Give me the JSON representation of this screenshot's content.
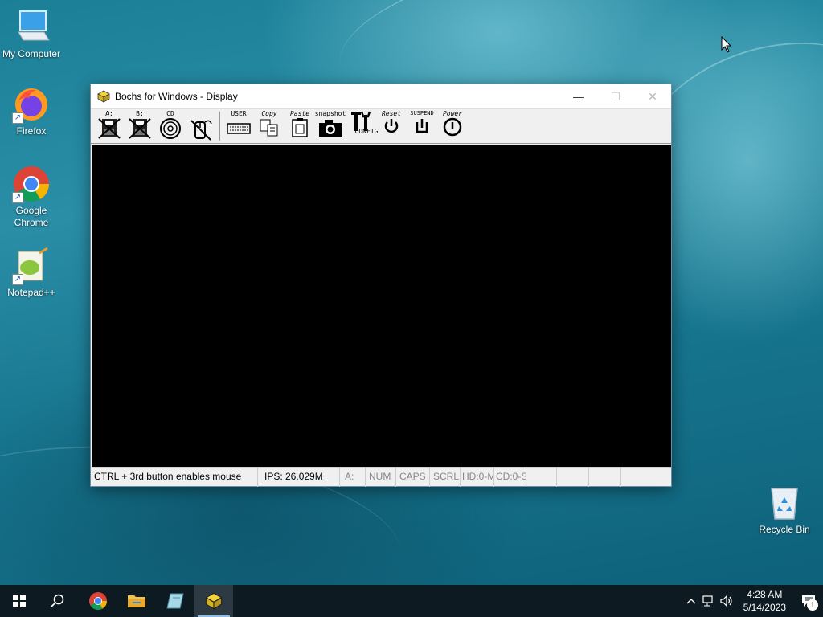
{
  "desktop": {
    "icons": [
      {
        "label": "My Computer",
        "icon": "computer-icon"
      },
      {
        "label": "Firefox",
        "icon": "firefox-icon"
      },
      {
        "label": "Google Chrome",
        "icon": "chrome-icon"
      },
      {
        "label": "Notepad++",
        "icon": "notepad-plus-plus-icon"
      }
    ],
    "recycle_bin": {
      "label": "Recycle Bin",
      "icon": "recycle-bin-icon"
    }
  },
  "window": {
    "title": "Bochs for Windows - Display",
    "controls": {
      "minimize": "—",
      "maximize": "☐",
      "close": "✕"
    },
    "toolbar": {
      "floppy_a": "A:",
      "floppy_b": "B:",
      "cdrom": "CD",
      "mouse": "",
      "user": "USER",
      "copy": "Copy",
      "paste": "Paste",
      "snapshot": "snapshot",
      "config": "CONFIG",
      "reset": "Reset",
      "suspend": "SUSPEND",
      "power": "Power"
    },
    "status": {
      "mouse_hint": "CTRL + 3rd button enables mouse",
      "ips": "IPS: 26.029M",
      "drive": "A:",
      "num": "NUM",
      "caps": "CAPS",
      "scrl": "SCRL",
      "hd": "HD:0-M",
      "cd": "CD:0-S"
    }
  },
  "taskbar": {
    "time": "4:28 AM",
    "date": "5/14/2023",
    "notification_count": "1"
  },
  "colors": {
    "taskbar_bg": "#0e1a22",
    "accent": "#8bbde6",
    "display_bg": "#000000"
  }
}
